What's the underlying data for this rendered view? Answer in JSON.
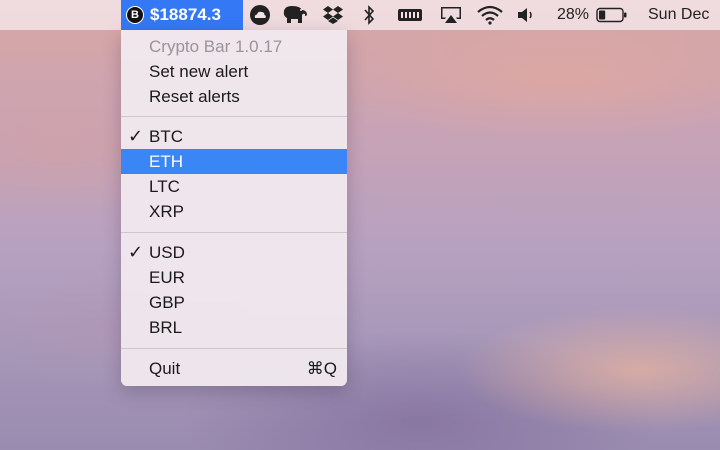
{
  "menubar": {
    "crypto_item": {
      "coin_badge": "B",
      "price": "$18874.3"
    },
    "battery": {
      "percent_label": "28%",
      "level": 0.28
    },
    "datetime": "Sun Dec",
    "status_icons": [
      "cloud-icon",
      "elephant-icon",
      "dropbox-icon",
      "bluetooth-icon",
      "memory-icon",
      "airplay-icon",
      "wifi-icon",
      "volume-icon",
      "battery-icon"
    ]
  },
  "menu": {
    "app_version": "Crypto Bar 1.0.17",
    "actions": {
      "set_alert": "Set new alert",
      "reset_alerts": "Reset alerts"
    },
    "coins": [
      {
        "label": "BTC",
        "checked": true,
        "selected": false
      },
      {
        "label": "ETH",
        "checked": false,
        "selected": true
      },
      {
        "label": "LTC",
        "checked": false,
        "selected": false
      },
      {
        "label": "XRP",
        "checked": false,
        "selected": false
      }
    ],
    "currencies": [
      {
        "label": "USD",
        "checked": true
      },
      {
        "label": "EUR",
        "checked": false
      },
      {
        "label": "GBP",
        "checked": false
      },
      {
        "label": "BRL",
        "checked": false
      }
    ],
    "check_mark": "✓",
    "quit": {
      "label": "Quit",
      "shortcut": "⌘Q"
    }
  },
  "colors": {
    "accent": "#3478f6",
    "selection": "#3b86f7"
  }
}
